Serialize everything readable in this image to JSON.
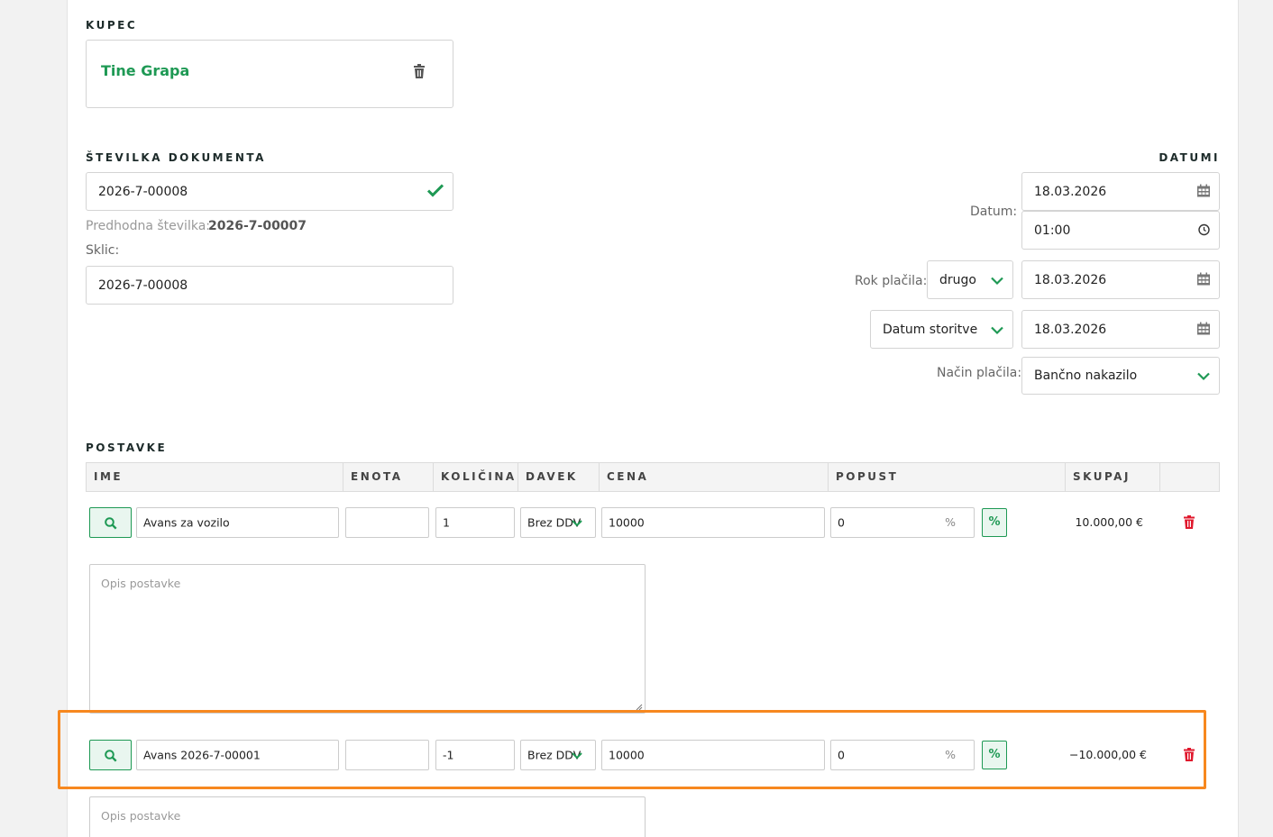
{
  "customer": {
    "section_title": "KUPEC",
    "name": "Tine Grapa"
  },
  "document_number": {
    "section_title": "ŠTEVILKA DOKUMENTA",
    "value": "2026-7-00008",
    "previous_label": "Predhodna številka:",
    "previous_value": "2026-7-00007",
    "reference_label": "Sklic:",
    "reference_value": "2026-7-00008"
  },
  "dates": {
    "section_title": "DATUMI",
    "date_label": "Datum:",
    "date_value": "18.03.2026",
    "time_value": "01:00",
    "due_label": "Rok plačila:",
    "due_option": "drugo",
    "due_date": "18.03.2026",
    "service_option": "Datum storitve",
    "service_date": "18.03.2026",
    "payment_label": "Način plačila:",
    "payment_value": "Bančno nakazilo"
  },
  "items": {
    "section_title": "POSTAVKE",
    "columns": [
      "IME",
      "ENOTA",
      "KOLIČINA",
      "DAVEK",
      "CENA",
      "POPUST",
      "SKUPAJ"
    ],
    "description_placeholder": "Opis postavke",
    "rows": [
      {
        "name": "Avans za vozilo",
        "unit": "",
        "quantity": "1",
        "tax": "Brez DDV",
        "price": "10000",
        "discount": "0",
        "discount_unit": "%",
        "discount_toggle": "%",
        "total": "10.000,00 €"
      },
      {
        "name": "Avans 2026-7-00001",
        "unit": "",
        "quantity": "-1",
        "tax": "Brez DDV",
        "price": "10000",
        "discount": "0",
        "discount_unit": "%",
        "discount_toggle": "%",
        "total": "−10.000,00 €"
      }
    ]
  },
  "colors": {
    "accent": "#1e9954",
    "delete": "#e0182d",
    "highlight": "#f7881f"
  }
}
